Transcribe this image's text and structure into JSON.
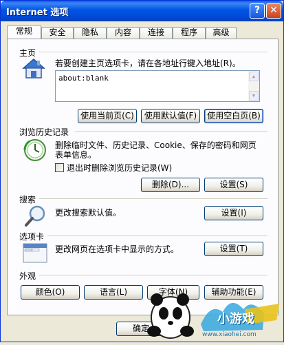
{
  "window": {
    "title": "Internet 选项",
    "help_label": "?",
    "close_label": "✕"
  },
  "tabs": [
    {
      "label": "常规",
      "active": true
    },
    {
      "label": "安全"
    },
    {
      "label": "隐私"
    },
    {
      "label": "内容"
    },
    {
      "label": "连接"
    },
    {
      "label": "程序"
    },
    {
      "label": "高级"
    }
  ],
  "home": {
    "group_label": "主页",
    "icon": "house-icon",
    "description": "若要创建主页选项卡，请在各地址行键入地址(R)。",
    "address_value": "about:blank",
    "buttons": {
      "use_current": "使用当前页(C)",
      "use_default": "使用默认值(F)",
      "use_blank": "使用空白页(B)"
    }
  },
  "history": {
    "group_label": "浏览历史记录",
    "icon": "clock-icon",
    "description_line1": "删除临时文件、历史记录、Cookie、保存的密码和网页",
    "description_line2": "表单信息。",
    "checkbox_label": "退出时删除浏览历史记录(W)",
    "checkbox_checked": false,
    "delete_button": "删除(D)...",
    "settings_button": "设置(S)"
  },
  "search": {
    "group_label": "搜索",
    "icon": "magnifier-icon",
    "description": "更改搜索默认值。",
    "settings_button": "设置(I)"
  },
  "tabs_section": {
    "group_label": "选项卡",
    "icon": "window-tabs-icon",
    "description": "更改网页在选项卡中显示的方式。",
    "settings_button": "设置(T)"
  },
  "appearance": {
    "group_label": "外观",
    "buttons": {
      "colors": "颜色(O)",
      "languages": "语言(L)",
      "fonts": "字体(N)",
      "accessibility": "辅助功能(E)"
    }
  },
  "footer": {
    "ok_button": "确定"
  },
  "watermark": {
    "brand": "小游戏",
    "url": "www.xiaohei.com"
  }
}
